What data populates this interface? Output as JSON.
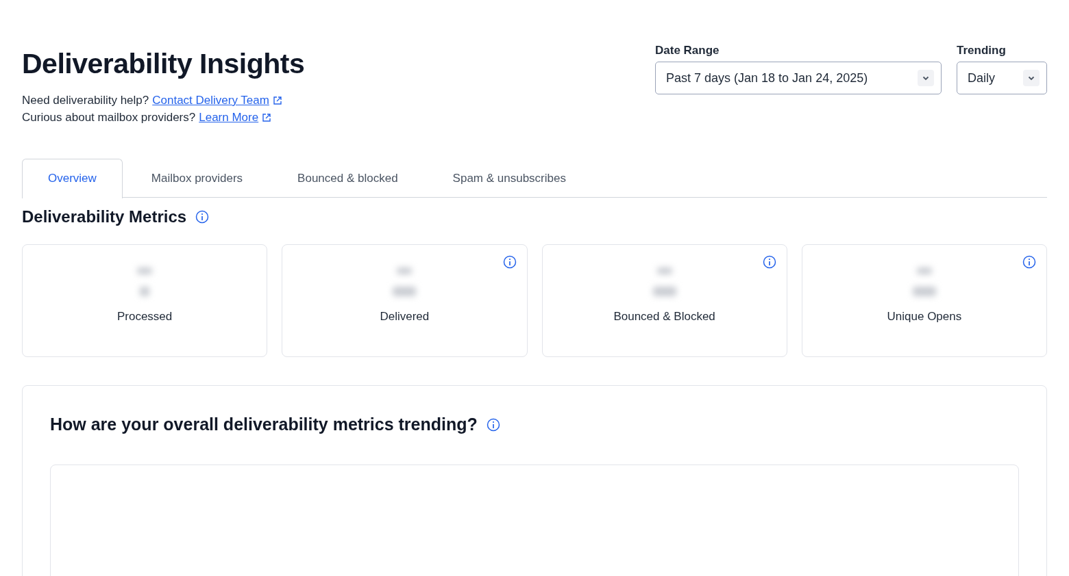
{
  "header": {
    "title": "Deliverability Insights",
    "help_lines": [
      {
        "text": "Need deliverability help?",
        "link": "Contact Delivery Team"
      },
      {
        "text": "Curious about mailbox providers?",
        "link": "Learn More"
      }
    ]
  },
  "filters": [
    {
      "label": "Date Range",
      "value": "Past 7 days (Jan 18 to Jan 24, 2025)",
      "kind": "wide"
    },
    {
      "label": "Trending",
      "value": "Daily",
      "kind": "narrow"
    }
  ],
  "tabs": [
    {
      "label": "Overview",
      "selected": true
    },
    {
      "label": "Mailbox providers",
      "selected": false
    },
    {
      "label": "Bounced & blocked",
      "selected": false
    },
    {
      "label": "Spam & unsubscribes",
      "selected": false
    }
  ],
  "metrics_section": {
    "title": "Deliverability Metrics",
    "cards": [
      {
        "label": "Processed",
        "info": false
      },
      {
        "label": "Delivered",
        "info": true
      },
      {
        "label": "Bounced & Blocked",
        "info": true
      },
      {
        "label": "Unique Opens",
        "info": true
      }
    ]
  },
  "trend_section": {
    "title": "How are your overall deliverability metrics trending?"
  }
}
